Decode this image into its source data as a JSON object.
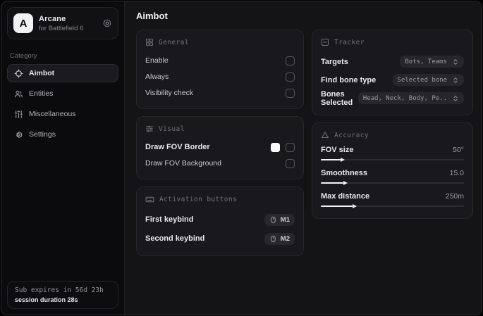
{
  "app": {
    "name": "Arcane",
    "subtitle": "for Battlefield 6",
    "logo_letter": "A"
  },
  "sidebar": {
    "category_label": "Category",
    "items": [
      {
        "label": "Aimbot",
        "icon": "crosshair-icon",
        "selected": true
      },
      {
        "label": "Entities",
        "icon": "entities-icon",
        "selected": false
      },
      {
        "label": "Miscellaneous",
        "icon": "sliders-icon",
        "selected": false
      },
      {
        "label": "Settings",
        "icon": "gear-icon",
        "selected": false
      }
    ],
    "footer": {
      "sub_expiry": "Sub expires in 56d 23h",
      "session_duration": "session duration 28s"
    }
  },
  "main": {
    "title": "Aimbot",
    "general": {
      "title": "General",
      "rows": [
        {
          "label": "Enable",
          "checked": false
        },
        {
          "label": "Always",
          "checked": false
        },
        {
          "label": "Visibility check",
          "checked": false
        }
      ]
    },
    "visual": {
      "title": "Visual",
      "rows": [
        {
          "label": "Draw FOV Border",
          "swatch_color": "#ffffff",
          "checked": false
        },
        {
          "label": "Draw FOV Background",
          "checked": false
        }
      ]
    },
    "activation": {
      "title": "Activation buttons",
      "rows": [
        {
          "label": "First keybind",
          "key": "M1"
        },
        {
          "label": "Second keybind",
          "key": "M2"
        }
      ]
    },
    "tracker": {
      "title": "Tracker",
      "rows": [
        {
          "label": "Targets",
          "value": "Bots, Teams"
        },
        {
          "label": "Find bone type",
          "value": "Selected bone"
        },
        {
          "label": "Bones Selected",
          "value": "Head, Neck, Body, Pe.."
        }
      ]
    },
    "accuracy": {
      "title": "Accuracy",
      "rows": [
        {
          "label": "FOV size",
          "value": "50°",
          "fill_percent": 14
        },
        {
          "label": "Smoothness",
          "value": "15.0",
          "fill_percent": 16
        },
        {
          "label": "Max distance",
          "value": "250m",
          "fill_percent": 22
        }
      ]
    }
  },
  "colors": {
    "accent_swatch": "#ffffff"
  }
}
